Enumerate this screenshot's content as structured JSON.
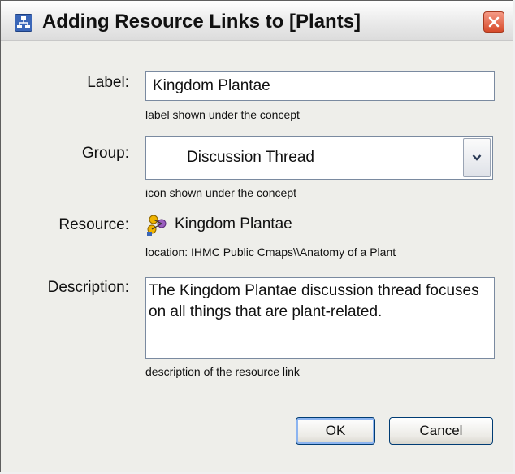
{
  "window": {
    "title": "Adding Resource Links to [Plants]",
    "icons": {
      "app": "cmap-app-icon",
      "close": "close-icon"
    },
    "colors": {
      "close_button": "#d64a2a",
      "focus_ring": "#8cb4f0"
    }
  },
  "form": {
    "label": {
      "caption": "Label:",
      "value": "Kingdom Plantae",
      "hint": "label shown under the concept"
    },
    "group": {
      "caption": "Group:",
      "selected": "Discussion Thread",
      "hint": "icon shown under the concept"
    },
    "resource": {
      "caption": "Resource:",
      "name": "Kingdom Plantae",
      "location": "location: IHMC Public Cmaps\\\\Anatomy of a Plant",
      "icon": "concept-map-resource-icon"
    },
    "description": {
      "caption": "Description:",
      "value": "The Kingdom Plantae discussion thread focuses on all things that are plant-related.",
      "hint": "description of the resource link"
    }
  },
  "buttons": {
    "ok": "OK",
    "cancel": "Cancel"
  }
}
